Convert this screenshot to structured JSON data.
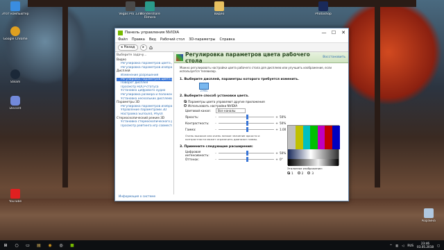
{
  "window": {
    "title": "Панель управления NVIDIA",
    "min": "—",
    "max": "☐",
    "close": "✕"
  },
  "menu": [
    "Файл",
    "Правка",
    "Вид",
    "Рабочий стол",
    "3D-параметры",
    "Справка"
  ],
  "toolbar": {
    "back": "Назад",
    "forward": "▸",
    "home_icon": "home-icon"
  },
  "left_panel": {
    "head": "Выберите задачу...",
    "groups": [
      {
        "cat": "Видео",
        "items": []
      },
      {
        "cat": "",
        "items": [
          "Регулировка параметров цвета для видео",
          "Регулировка параметров изображения для видео"
        ]
      },
      {
        "cat": "Дисплей",
        "items": [
          "Изменение разрешения",
          "Регулировка параметров цвета рабочего стола",
          "Поворот дисплея",
          "Просмотр HDCP-статуса",
          "Установка цифрового аудио",
          "Регулировка размера и положения рабочего стола",
          "Установка нескольких дисплеев"
        ]
      },
      {
        "cat": "Параметры 3D",
        "items": [
          "Регулировка параметров изображения с просмотром",
          "Управление параметрами 3D",
          "Настройка Surround, PhysX"
        ]
      },
      {
        "cat": "Стереоскопический режим 3D",
        "items": [
          "Установка стереоскопического режима 3D",
          "Просмотр рейтинга игр совместимости"
        ]
      }
    ],
    "selected": "Регулировка параметров цвета рабочего стола",
    "sysinfo": "Информация о системе"
  },
  "content": {
    "title": "Регулировка параметров цвета рабочего стола",
    "restore": "Восстановить",
    "desc": "Можно регулировать настройки цвета рабочего стола для дисплеев или улучшить изображение, если используется телевизор.",
    "sec1": "1. Выберите дисплей, параметры которого требуется изменить.",
    "monitor_label": "2795L",
    "sec2": "2. Выберите способ установки цвета.",
    "radio1": "Параметры цвета управляют другие приложения",
    "radio2": "Использовать настройки NVIDIA",
    "channel_label": "Цветовой канал:",
    "channel_value": "Все каналы",
    "sliders": [
      {
        "label": "Яркость:",
        "value": "50%",
        "pos": 0.5
      },
      {
        "label": "Контрастность:",
        "value": "50%",
        "pos": 0.5
      },
      {
        "label": "Гамма:",
        "value": "1.00",
        "pos": 0.5
      }
    ],
    "note": "Очень высокое или очень низкое значение яркости и контрастности может ограничить диапазон гаммы.",
    "sec3": "3. Примените следующие расширения:",
    "ext": [
      {
        "label": "Цифровая интенсивность:",
        "value": "50%",
        "pos": 0.5
      },
      {
        "label": "Оттенок:",
        "value": "0°",
        "pos": 0.5
      }
    ],
    "ref_label": "Эталонное изображение:",
    "ref_opts": [
      "1",
      "2",
      "3"
    ]
  },
  "desktop_icons": [
    {
      "label": "Этот компьютер",
      "color": "#3a8de0"
    },
    {
      "label": "Google Chrome",
      "color": "#e0a020"
    },
    {
      "label": "Steam",
      "color": "#1b2838"
    },
    {
      "label": "Discord",
      "color": "#7289da"
    },
    {
      "label": "Vegas Pro 13.0",
      "color": "#4a4a4a"
    },
    {
      "label": "Wondershare Filmora",
      "color": "#2a9a8a"
    },
    {
      "label": "Видео",
      "color": "#e8c060"
    },
    {
      "label": "Photoshop",
      "color": "#1a2a5a"
    },
    {
      "label": "Корзина",
      "color": "#b0c8e0"
    },
    {
      "label": "YouTube",
      "color": "#e02020"
    }
  ],
  "taskbar": {
    "time": "23:46",
    "date": "03.05.2018",
    "lang": "RUS"
  },
  "colors": {
    "nvidia_green": "#76b900",
    "selection": "#3875d7"
  }
}
